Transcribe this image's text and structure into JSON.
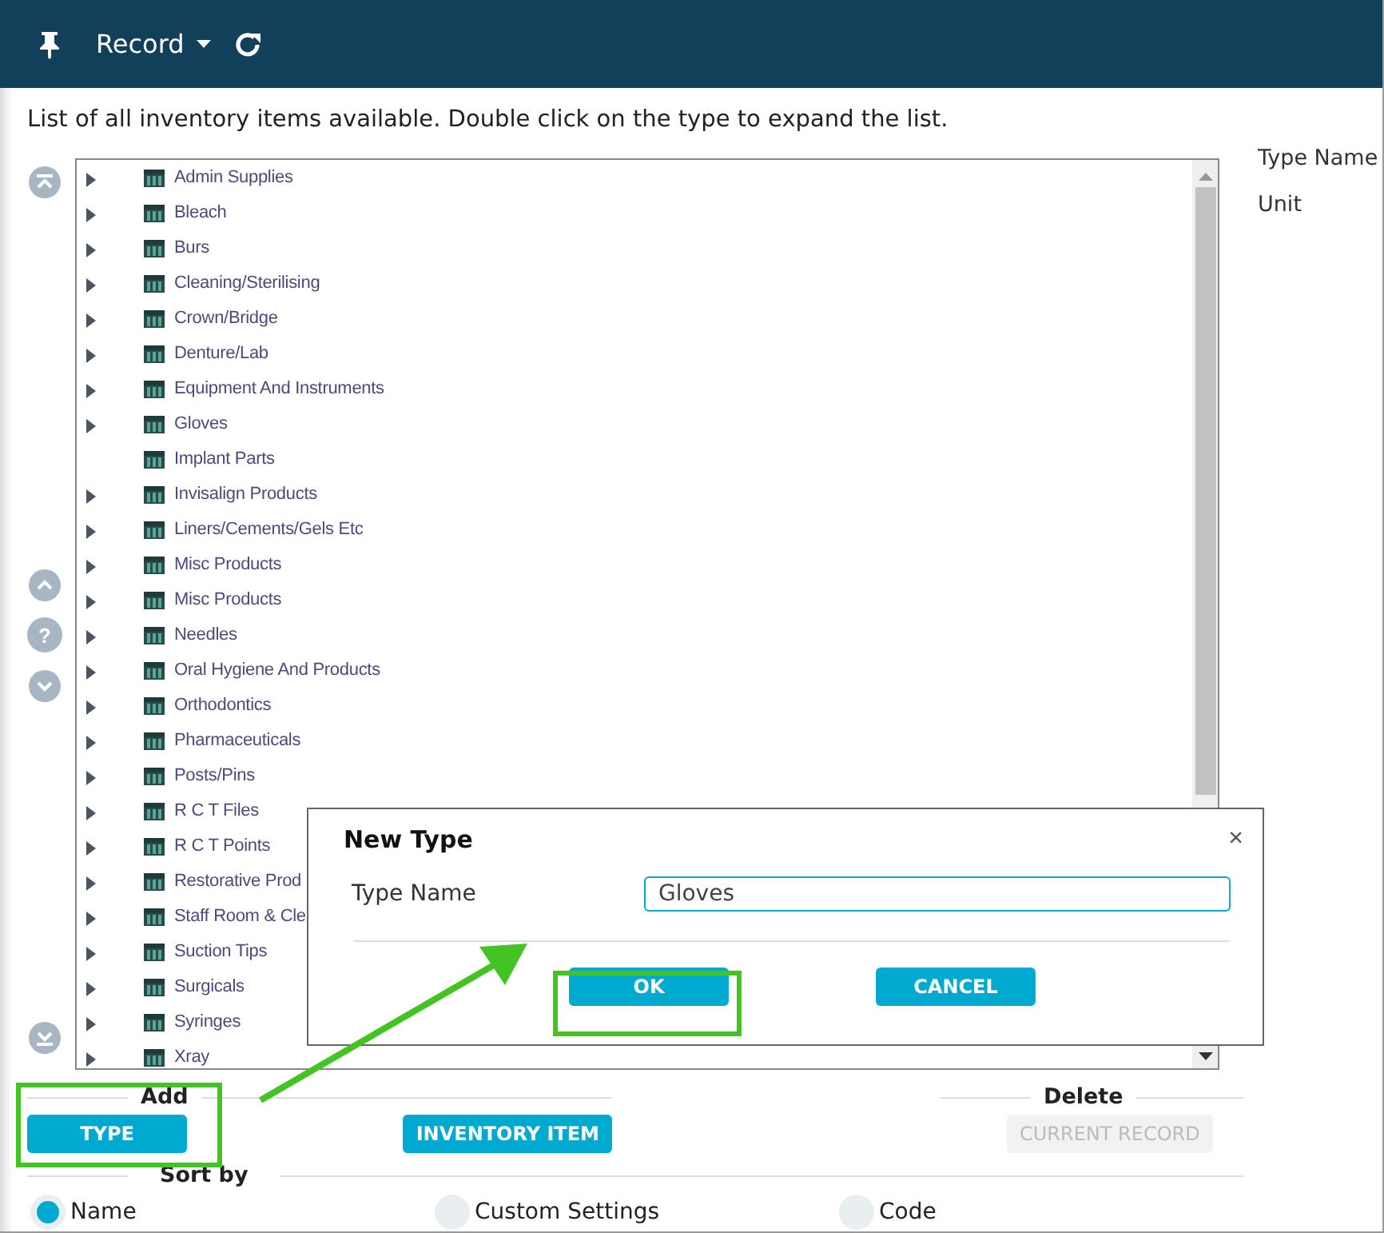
{
  "toolbar": {
    "menu_label": "Record"
  },
  "description": "List of all inventory items available. Double click on the type to expand the list.",
  "nav_buttons": [
    {
      "kind": "top"
    },
    {
      "kind": "up"
    },
    {
      "kind": "help",
      "label": "?"
    },
    {
      "kind": "down"
    },
    {
      "kind": "bottom"
    }
  ],
  "tree": {
    "items": [
      {
        "label": "Admin Supplies",
        "expandable": true
      },
      {
        "label": "Bleach",
        "expandable": true
      },
      {
        "label": "Burs",
        "expandable": true
      },
      {
        "label": "Cleaning/Sterilising",
        "expandable": true
      },
      {
        "label": "Crown/Bridge",
        "expandable": true
      },
      {
        "label": "Denture/Lab",
        "expandable": true
      },
      {
        "label": "Equipment And Instruments",
        "expandable": true
      },
      {
        "label": "Gloves",
        "expandable": true
      },
      {
        "label": "Implant Parts",
        "expandable": false
      },
      {
        "label": "Invisalign Products",
        "expandable": true
      },
      {
        "label": "Liners/Cements/Gels Etc",
        "expandable": true
      },
      {
        "label": "Misc Products",
        "expandable": true
      },
      {
        "label": "Misc Products",
        "expandable": true
      },
      {
        "label": "Needles",
        "expandable": true
      },
      {
        "label": "Oral Hygiene And Products",
        "expandable": true
      },
      {
        "label": "Orthodontics",
        "expandable": true
      },
      {
        "label": "Pharmaceuticals",
        "expandable": true
      },
      {
        "label": "Posts/Pins",
        "expandable": true
      },
      {
        "label": "R C T Files",
        "expandable": true
      },
      {
        "label": "R C T Points",
        "expandable": true
      },
      {
        "label": "Restorative Prod",
        "expandable": true
      },
      {
        "label": "Staff Room & Cle",
        "expandable": true
      },
      {
        "label": "Suction Tips",
        "expandable": true
      },
      {
        "label": "Surgicals",
        "expandable": true
      },
      {
        "label": "Syringes",
        "expandable": true
      },
      {
        "label": "Xray",
        "expandable": true
      }
    ]
  },
  "details": {
    "labels": [
      "Type Name",
      "Unit"
    ]
  },
  "actions": {
    "add": {
      "heading": "Add",
      "buttons": [
        {
          "label": "TYPE",
          "disabled": false
        },
        {
          "label": "INVENTORY ITEM",
          "disabled": false
        }
      ]
    },
    "delete": {
      "heading": "Delete",
      "buttons": [
        {
          "label": "CURRENT RECORD",
          "disabled": true
        }
      ]
    }
  },
  "sort": {
    "heading": "Sort by",
    "options": [
      {
        "label": "Name",
        "selected": true
      },
      {
        "label": "Custom Settings",
        "selected": false
      },
      {
        "label": "Code",
        "selected": false
      }
    ]
  },
  "dialog": {
    "title": "New Type",
    "close": "×",
    "field_label": "Type Name",
    "field_value": "Gloves",
    "buttons": [
      "OK",
      "CANCEL"
    ]
  }
}
